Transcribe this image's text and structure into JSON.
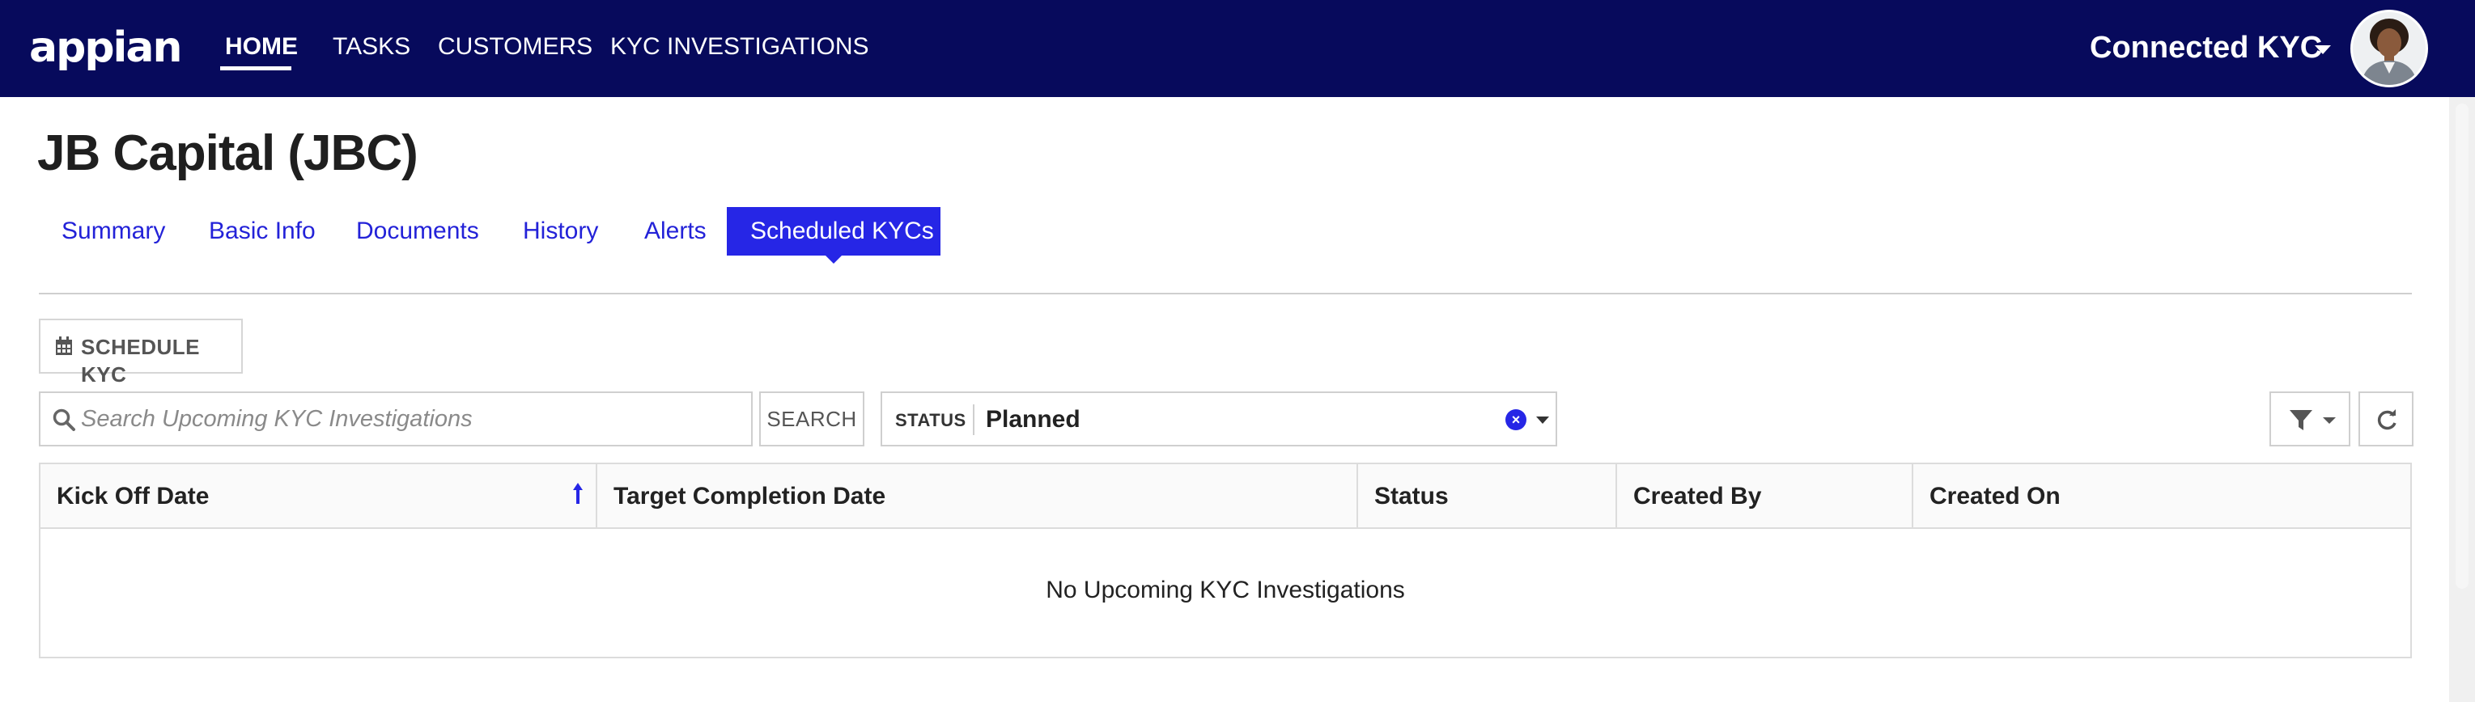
{
  "header": {
    "logo": "appian",
    "nav": [
      "HOME",
      "TASKS",
      "CUSTOMERS",
      "KYC INVESTIGATIONS"
    ],
    "active_nav": "HOME",
    "app_name": "Connected KYC",
    "brand_color": "#070a5c"
  },
  "page": {
    "title": "JB Capital (JBC)"
  },
  "tabs": [
    "Summary",
    "Basic Info",
    "Documents",
    "History",
    "Alerts",
    "Scheduled KYCs"
  ],
  "active_tab": "Scheduled KYCs",
  "accent_color": "#2626e6",
  "toolbar": {
    "schedule_label": "SCHEDULE KYC",
    "search_placeholder": "Search Upcoming KYC Investigations",
    "search_button": "SEARCH",
    "status_filter_label": "STATUS",
    "status_filter_value": "Planned"
  },
  "grid": {
    "columns": [
      "Kick Off Date",
      "Target Completion Date",
      "Status",
      "Created By",
      "Created On"
    ],
    "sorted_column": "Kick Off Date",
    "sort_direction": "ascending",
    "rows": [],
    "empty_message": "No Upcoming KYC Investigations"
  },
  "icons": {
    "schedule": "calendar-icon",
    "search": "search-icon",
    "clear_filter": "clear-circle-icon",
    "filter": "filter-icon",
    "refresh": "refresh-icon",
    "sort": "sort-ascending-icon"
  }
}
